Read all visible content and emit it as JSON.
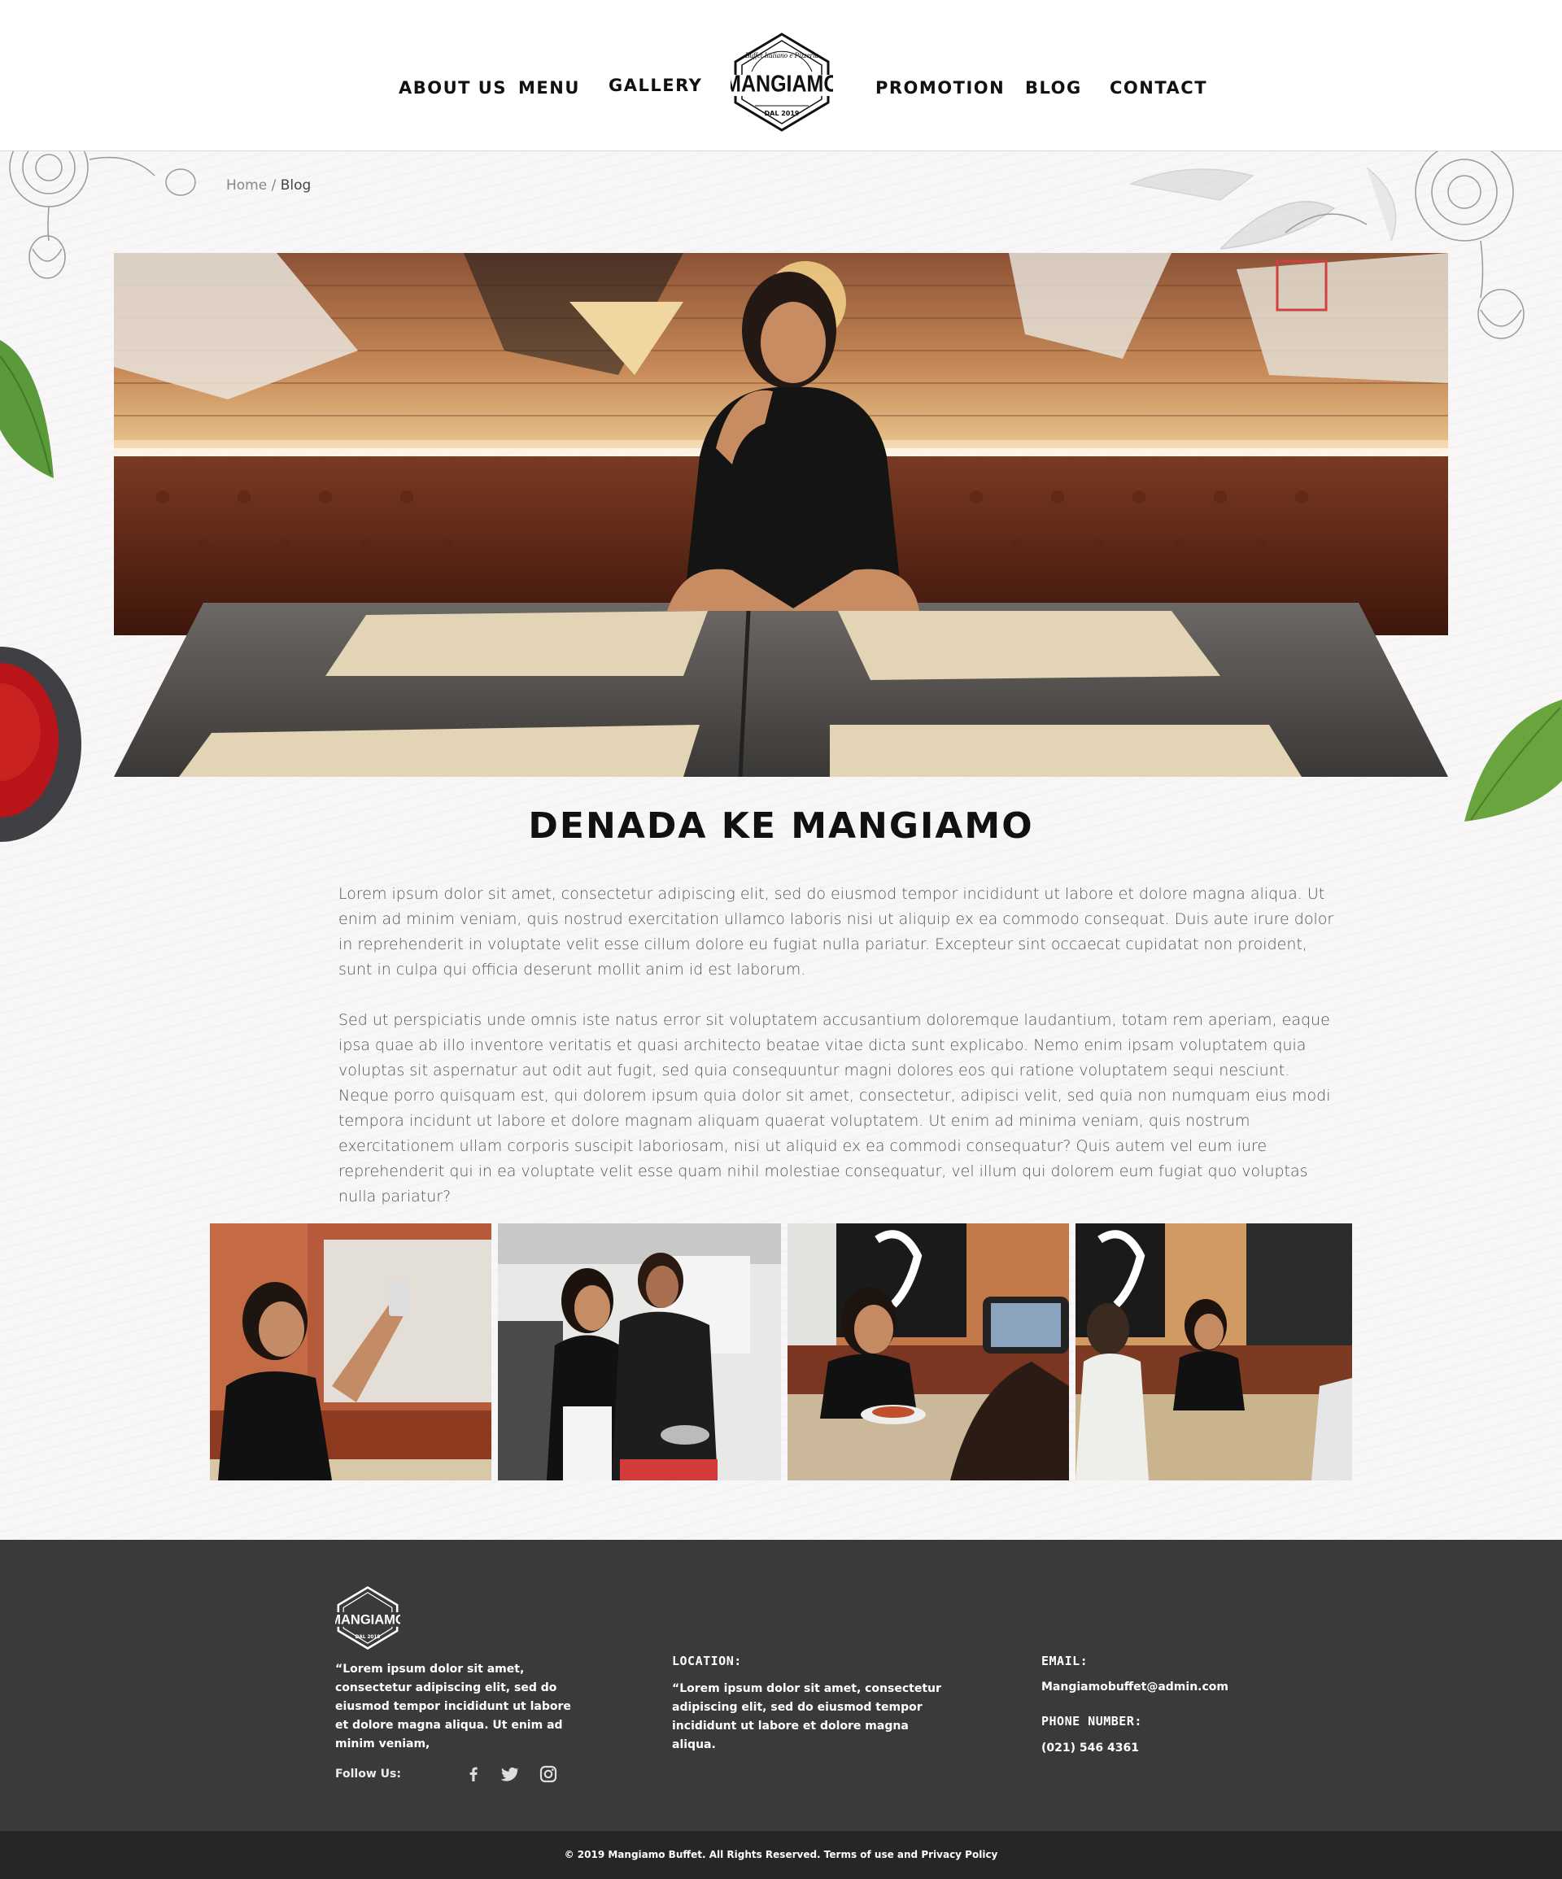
{
  "nav": {
    "left": [
      "ABOUT US",
      "MENU",
      "GALLERY"
    ],
    "right": [
      "PROMOTION",
      "BLOG",
      "CONTACT"
    ],
    "logo": {
      "text": "MANGIAMO",
      "arc_text": "Buffet Italiano e Pizzeria",
      "est": "DAL 2019"
    }
  },
  "breadcrumb": {
    "home": "Home",
    "separator": " / ",
    "current": "Blog"
  },
  "post": {
    "title": "DENADA KE MANGIAMO",
    "paragraphs": [
      "Lorem ipsum dolor sit amet, consectetur adipiscing elit, sed do eiusmod tempor incididunt ut labore et dolore magna aliqua. Ut enim ad minim veniam, quis nostrud exercitation ullamco laboris nisi ut aliquip ex ea commodo consequat. Duis aute irure dolor in reprehenderit in voluptate velit esse cillum dolore eu fugiat nulla pariatur. Excepteur sint occaecat cupidatat non proident, sunt in culpa qui officia deserunt mollit anim id est laborum.",
      "Sed ut perspiciatis unde omnis iste natus error sit voluptatem accusantium doloremque laudantium, totam rem aperiam, eaque ipsa quae ab illo inventore veritatis et quasi architecto beatae vitae dicta sunt explicabo. Nemo enim ipsam voluptatem quia voluptas sit aspernatur aut odit aut fugit, sed quia consequuntur magni dolores eos qui ratione voluptatem sequi nesciunt. Neque porro quisquam est, qui dolorem ipsum quia dolor sit amet, consectetur, adipisci velit, sed quia non numquam eius modi tempora incidunt ut labore et dolore magnam aliquam quaerat voluptatem. Ut enim ad minima veniam, quis nostrum exercitationem ullam corporis suscipit laboriosam, nisi ut aliquid ex ea commodi consequatur? Quis autem vel eum iure reprehenderit qui in ea voluptate velit esse quam nihil molestiae consequatur, vel illum qui dolorem eum fugiat quo voluptas nulla pariatur?"
    ]
  },
  "gallery": {
    "count": 4
  },
  "footer": {
    "quote": "“Lorem ipsum dolor sit amet, consectetur adipiscing elit, sed do eiusmod tempor incididunt ut labore et dolore magna aliqua. Ut enim ad minim veniam,",
    "follow_label": "Follow Us:",
    "social_icons": [
      "facebook-icon",
      "twitter-icon",
      "instagram-icon"
    ],
    "location_heading": "LOCATION:",
    "location_text": "“Lorem ipsum dolor sit amet, consectetur adipiscing elit, sed do eiusmod tempor incididunt ut labore et dolore magna aliqua.",
    "email_heading": "EMAIL:",
    "email_value": "Mangiamobuffet@admin.com",
    "phone_heading": "PHONE NUMBER:",
    "phone_value": "(021) 546 4361",
    "copyright": "© 2019 Mangiamo Buffet. All Rights Reserved. Terms of use and Privacy Policy"
  },
  "colors": {
    "footer_bg": "#3a3a3a",
    "bottom_bar": "#262626",
    "text_dark": "#111111"
  }
}
